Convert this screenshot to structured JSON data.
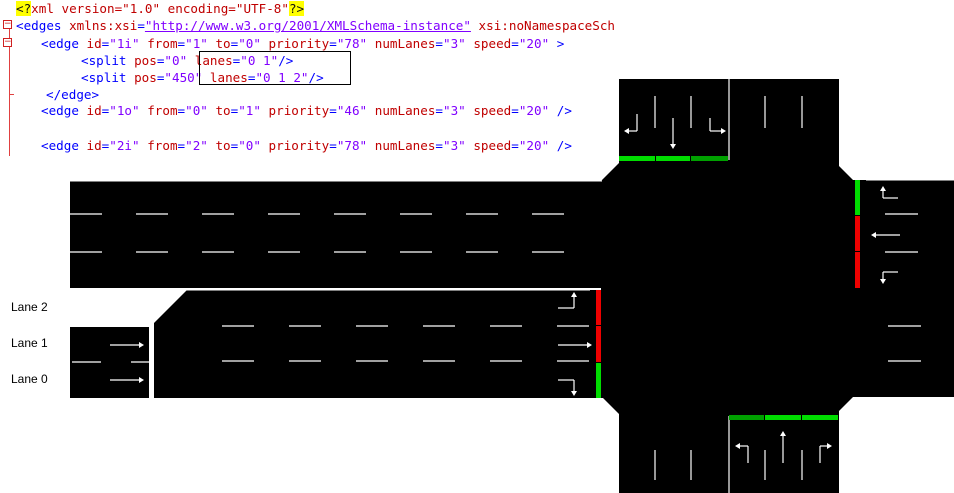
{
  "editor": {
    "lines": [
      {
        "id": "l1",
        "parts": [
          [
            "pi",
            "<?"
          ],
          [
            "pi-text",
            "xml version=\"1.0\" encoding=\"UTF-8\""
          ],
          [
            "pi",
            "?>"
          ]
        ]
      },
      {
        "id": "l2",
        "parts": [
          [
            "tag",
            "<edges "
          ],
          [
            "attr",
            "xmlns:xsi"
          ],
          [
            "tag",
            "="
          ],
          [
            "link",
            "\"http://www.w3.org/2001/XMLSchema-instance\""
          ],
          [
            "attr",
            " xsi:noNamespaceSch"
          ]
        ]
      },
      {
        "id": "l3",
        "parts": [
          [
            "tag",
            "<edge "
          ],
          [
            "attr",
            "id"
          ],
          [
            "tag",
            "="
          ],
          [
            "val",
            "\"1i\""
          ],
          [
            "attr",
            " from"
          ],
          [
            "tag",
            "="
          ],
          [
            "val",
            "\"1\""
          ],
          [
            "attr",
            " to"
          ],
          [
            "tag",
            "="
          ],
          [
            "val",
            "\"0\""
          ],
          [
            "attr",
            " priority"
          ],
          [
            "tag",
            "="
          ],
          [
            "val",
            "\"78\""
          ],
          [
            "attr",
            " numLanes"
          ],
          [
            "tag",
            "="
          ],
          [
            "val",
            "\"3\""
          ],
          [
            "attr",
            " speed"
          ],
          [
            "tag",
            "="
          ],
          [
            "val",
            "\"20\""
          ],
          [
            "tag",
            " >"
          ]
        ]
      },
      {
        "id": "l4",
        "parts": [
          [
            "tag",
            "<split "
          ],
          [
            "attr",
            "pos"
          ],
          [
            "tag",
            "="
          ],
          [
            "val",
            "\"0\""
          ],
          [
            "attr",
            " lanes"
          ],
          [
            "tag",
            "="
          ],
          [
            "val",
            "\"0 1\""
          ],
          [
            "tag",
            "/>"
          ]
        ]
      },
      {
        "id": "l5",
        "parts": [
          [
            "tag",
            "<split "
          ],
          [
            "attr",
            "pos"
          ],
          [
            "tag",
            "="
          ],
          [
            "val",
            "\"450\""
          ],
          [
            "attr",
            " lanes"
          ],
          [
            "tag",
            "="
          ],
          [
            "val",
            "\"0 1 2\""
          ],
          [
            "tag",
            "/>"
          ]
        ]
      },
      {
        "id": "l6",
        "parts": [
          [
            "tag",
            "</edge>"
          ]
        ]
      },
      {
        "id": "l7",
        "parts": [
          [
            "tag",
            "<edge "
          ],
          [
            "attr",
            "id"
          ],
          [
            "tag",
            "="
          ],
          [
            "val",
            "\"1o\""
          ],
          [
            "attr",
            " from"
          ],
          [
            "tag",
            "="
          ],
          [
            "val",
            "\"0\""
          ],
          [
            "attr",
            " to"
          ],
          [
            "tag",
            "="
          ],
          [
            "val",
            "\"1\""
          ],
          [
            "attr",
            " priority"
          ],
          [
            "tag",
            "="
          ],
          [
            "val",
            "\"46\""
          ],
          [
            "attr",
            " numLanes"
          ],
          [
            "tag",
            "="
          ],
          [
            "val",
            "\"3\""
          ],
          [
            "attr",
            " speed"
          ],
          [
            "tag",
            "="
          ],
          [
            "val",
            "\"20\""
          ],
          [
            "tag",
            " />"
          ]
        ]
      },
      {
        "id": "l8",
        "parts": [
          [
            "tag",
            "<edge "
          ],
          [
            "attr",
            "id"
          ],
          [
            "tag",
            "="
          ],
          [
            "val",
            "\"2i\""
          ],
          [
            "attr",
            " from"
          ],
          [
            "tag",
            "="
          ],
          [
            "val",
            "\"2\""
          ],
          [
            "attr",
            " to"
          ],
          [
            "tag",
            "="
          ],
          [
            "val",
            "\"0\""
          ],
          [
            "attr",
            " priority"
          ],
          [
            "tag",
            "="
          ],
          [
            "val",
            "\"78\""
          ],
          [
            "attr",
            " numLanes"
          ],
          [
            "tag",
            "="
          ],
          [
            "val",
            "\"3\""
          ],
          [
            "attr",
            " speed"
          ],
          [
            "tag",
            "="
          ],
          [
            "val",
            "\"20\""
          ],
          [
            "tag",
            " />"
          ]
        ]
      }
    ]
  },
  "diagram": {
    "lane_labels": [
      "Lane 2",
      "Lane 1",
      "Lane 0"
    ],
    "colors": {
      "road": "#000000",
      "marking": "#ffffff",
      "signal_green": "#00dd00",
      "signal_green_dark": "#00a000",
      "signal_red": "#ee0000"
    },
    "signals": {
      "north_approach": [
        "green",
        "green",
        "green_dark"
      ],
      "east_approach": [
        "green",
        "red",
        "red"
      ],
      "west_approach": [
        "red",
        "red",
        "green"
      ],
      "south_approach": [
        "green_dark",
        "green",
        "green"
      ]
    }
  }
}
